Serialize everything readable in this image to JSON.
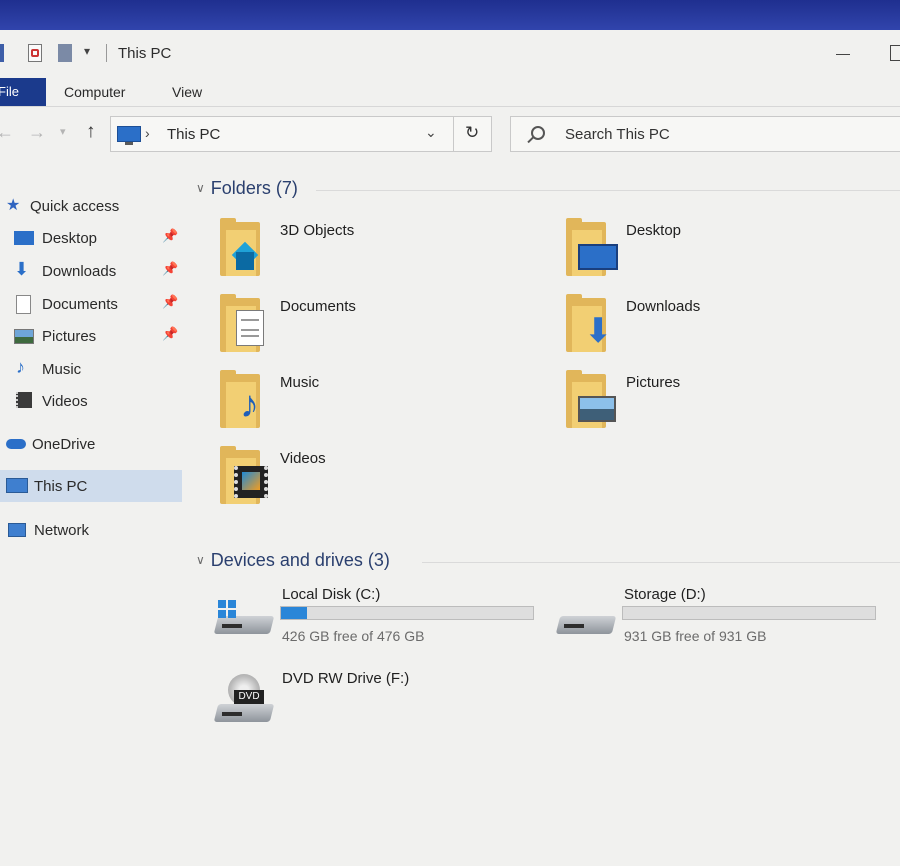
{
  "window": {
    "title": "This PC"
  },
  "ribbon": {
    "tabs": [
      "File",
      "Computer",
      "View"
    ]
  },
  "address": {
    "location": "This PC"
  },
  "search": {
    "placeholder": "Search This PC"
  },
  "sidebar": {
    "items": [
      {
        "label": "Quick access",
        "icon": "star-icon"
      },
      {
        "label": "Desktop",
        "icon": "desktop-icon",
        "pinned": true
      },
      {
        "label": "Downloads",
        "icon": "download-arrow-icon",
        "pinned": true
      },
      {
        "label": "Documents",
        "icon": "document-icon",
        "pinned": true
      },
      {
        "label": "Pictures",
        "icon": "pictures-icon",
        "pinned": true
      },
      {
        "label": "Music",
        "icon": "music-note-icon"
      },
      {
        "label": "Videos",
        "icon": "video-icon"
      },
      {
        "label": "OneDrive",
        "icon": "cloud-icon"
      },
      {
        "label": "This PC",
        "icon": "computer-icon",
        "selected": true
      },
      {
        "label": "Network",
        "icon": "network-icon"
      }
    ]
  },
  "folders": {
    "heading": "Folders (7)",
    "items": [
      {
        "label": "3D Objects",
        "icon": "3d-objects-folder-icon"
      },
      {
        "label": "Desktop",
        "icon": "desktop-folder-icon"
      },
      {
        "label": "Documents",
        "icon": "documents-folder-icon"
      },
      {
        "label": "Downloads",
        "icon": "downloads-folder-icon"
      },
      {
        "label": "Music",
        "icon": "music-folder-icon"
      },
      {
        "label": "Pictures",
        "icon": "pictures-folder-icon"
      },
      {
        "label": "Videos",
        "icon": "videos-folder-icon"
      }
    ]
  },
  "drives": {
    "heading": "Devices and drives (3)",
    "items": [
      {
        "name": "Local Disk (C:)",
        "free": "426 GB free of 476 GB",
        "used_fraction": 0.105,
        "icon": "windows-drive-icon"
      },
      {
        "name": "Storage (D:)",
        "free": "931 GB free of 931 GB",
        "used_fraction": 0.0,
        "icon": "hard-drive-icon"
      },
      {
        "name": "DVD RW Drive (F:)",
        "icon": "dvd-drive-icon"
      }
    ]
  },
  "colors": {
    "accent": "#2a86d8",
    "file_tab": "#1b3a8c",
    "folder": "#e1b65a",
    "selection": "#cfdcec"
  }
}
